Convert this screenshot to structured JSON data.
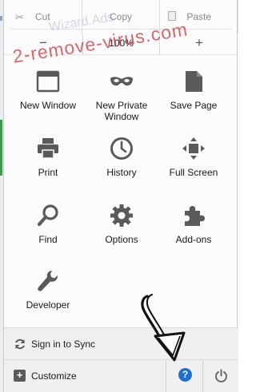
{
  "edit": {
    "cut": "Cut",
    "copy": "Copy",
    "paste": "Paste"
  },
  "zoom": {
    "minus": "−",
    "value": "100%",
    "plus": "+"
  },
  "tools": [
    {
      "label": "New Window",
      "icon": "window-icon"
    },
    {
      "label": "New Private Window",
      "icon": "mask-icon"
    },
    {
      "label": "Save Page",
      "icon": "page-icon"
    },
    {
      "label": "Print",
      "icon": "printer-icon"
    },
    {
      "label": "History",
      "icon": "clock-icon"
    },
    {
      "label": "Full Screen",
      "icon": "fullscreen-icon"
    },
    {
      "label": "Find",
      "icon": "magnifier-icon"
    },
    {
      "label": "Options",
      "icon": "gear-icon"
    },
    {
      "label": "Add-ons",
      "icon": "puzzle-icon"
    },
    {
      "label": "Developer",
      "icon": "wrench-icon"
    }
  ],
  "footer": {
    "sync": "Sign in to Sync",
    "customize": "Customize",
    "help": "?"
  },
  "watermark": {
    "main": "2-remove-virus.com",
    "secondary": "Wizard.Ads"
  },
  "colors": {
    "accent": "#1f6fd1",
    "icon": "#5a5a5a",
    "watermark": "#c82832"
  }
}
